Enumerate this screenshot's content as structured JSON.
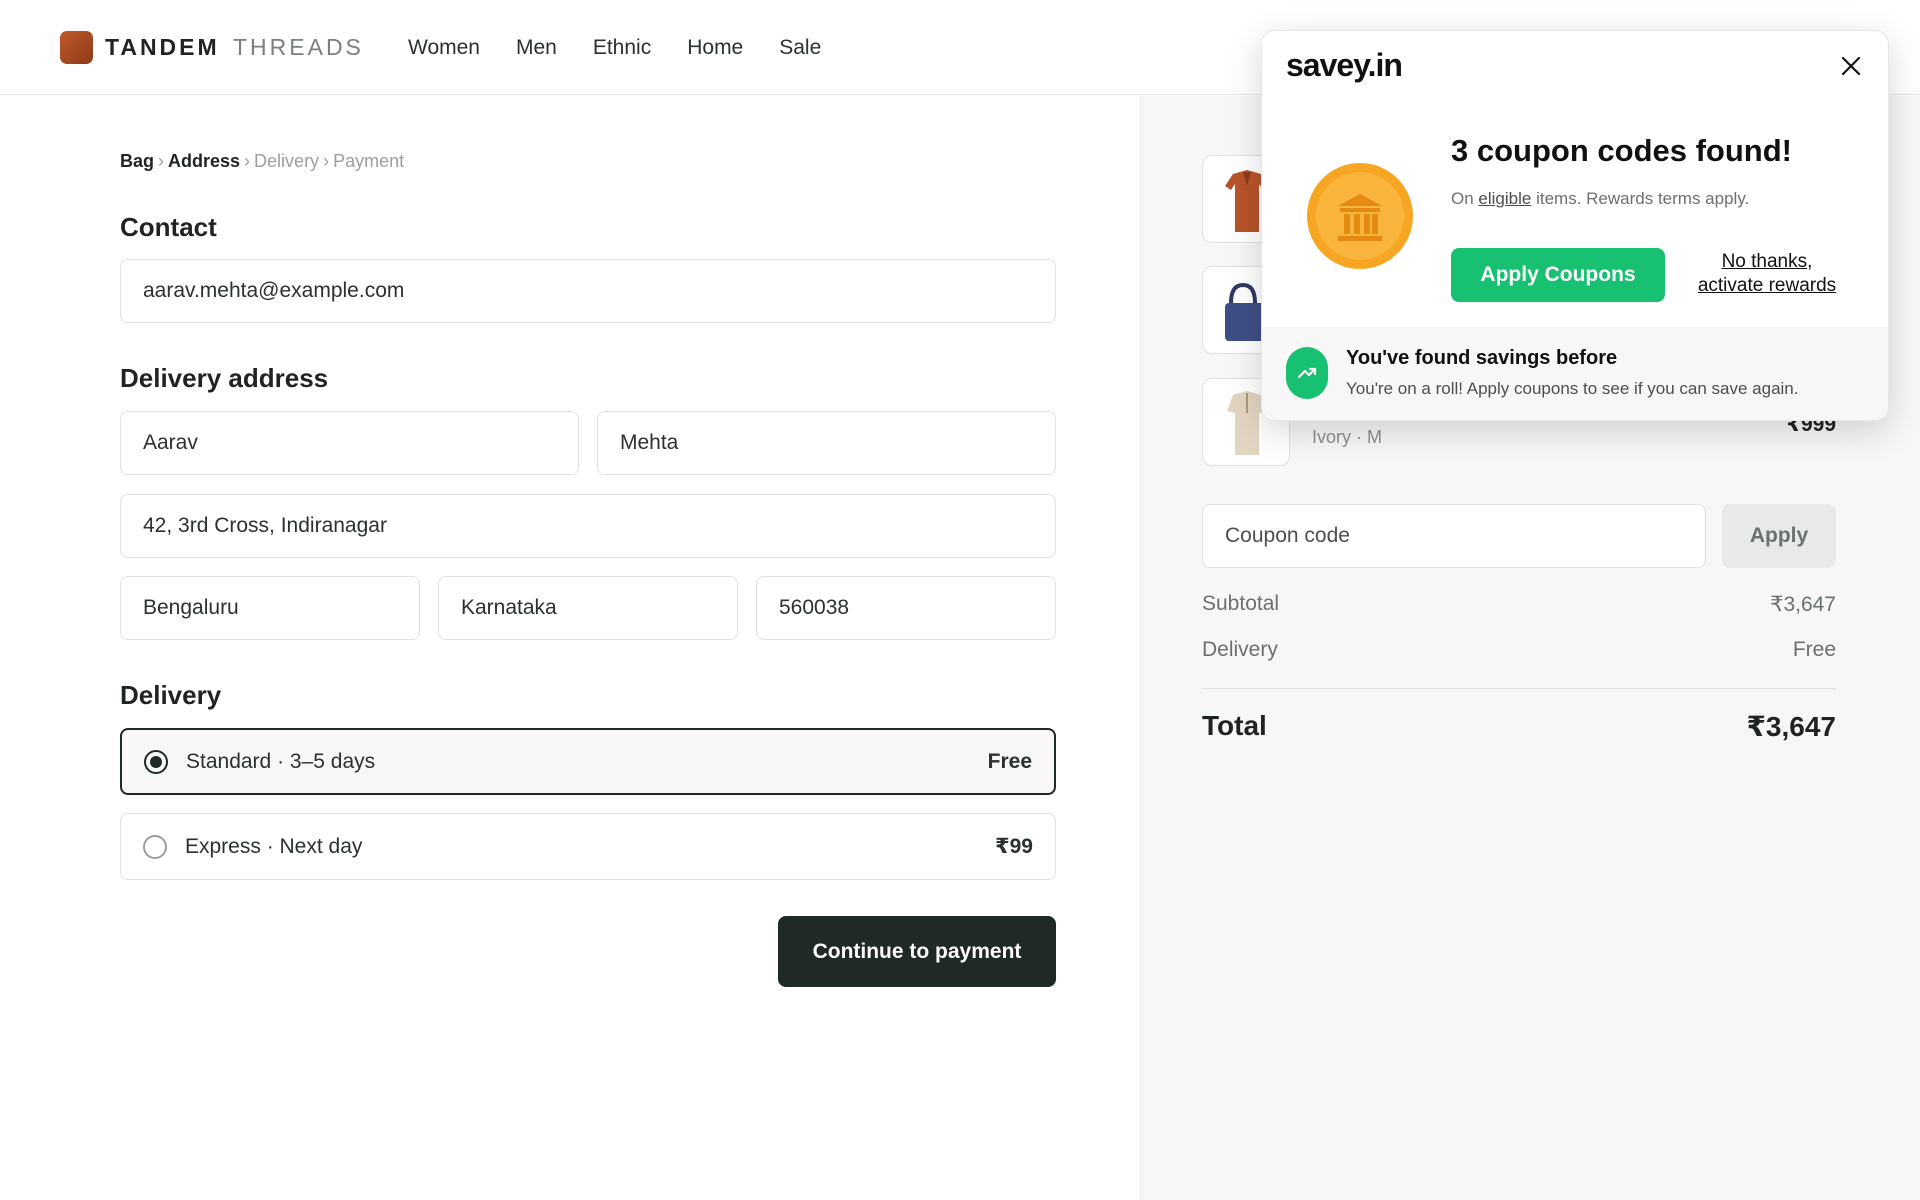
{
  "header": {
    "brand_primary": "TANDEM",
    "brand_secondary": "THREADS",
    "nav": [
      "Women",
      "Men",
      "Ethnic",
      "Home",
      "Sale"
    ]
  },
  "breadcrumb": {
    "bag": "Bag",
    "address": "Address",
    "delivery": "Delivery",
    "payment": "Payment",
    "separator": "›"
  },
  "contact": {
    "heading": "Contact",
    "email": "aarav.mehta@example.com"
  },
  "address": {
    "heading": "Delivery address",
    "first_name": "Aarav",
    "last_name": "Mehta",
    "street": "42, 3rd Cross, Indiranagar",
    "city": "Bengaluru",
    "state": "Karnataka",
    "pincode": "560038"
  },
  "delivery": {
    "heading": "Delivery",
    "options": [
      {
        "label": "Standard · 3–5 days",
        "price": "Free",
        "selected": true
      },
      {
        "label": "Express · Next day",
        "price": "₹99",
        "selected": false
      }
    ]
  },
  "cta": {
    "label": "Continue to payment"
  },
  "summary": {
    "visible_item_variant": "Ivory · M",
    "visible_item_price": "₹999",
    "coupon_placeholder": "Coupon code",
    "coupon_apply": "Apply",
    "subtotal_label": "Subtotal",
    "subtotal_value": "₹3,647",
    "delivery_label": "Delivery",
    "delivery_value": "Free",
    "total_label": "Total",
    "total_value": "₹3,647"
  },
  "popup": {
    "logo": "savey.in",
    "title": "3 coupon codes found!",
    "subtitle_prefix": "On",
    "subtitle_link": "eligible",
    "subtitle_suffix": "items. Rewards terms apply.",
    "apply_button": "Apply Coupons",
    "decline_line1": "No thanks,",
    "decline_line2": "activate rewards",
    "footer_title": "You've found savings before",
    "footer_text": "You're on a roll! Apply coupons to see if you can save again."
  },
  "colors": {
    "brand_accent": "#b24c22",
    "primary_dark": "#1f2a25",
    "popup_green": "#18c071",
    "coin_orange": "#f6a623"
  }
}
